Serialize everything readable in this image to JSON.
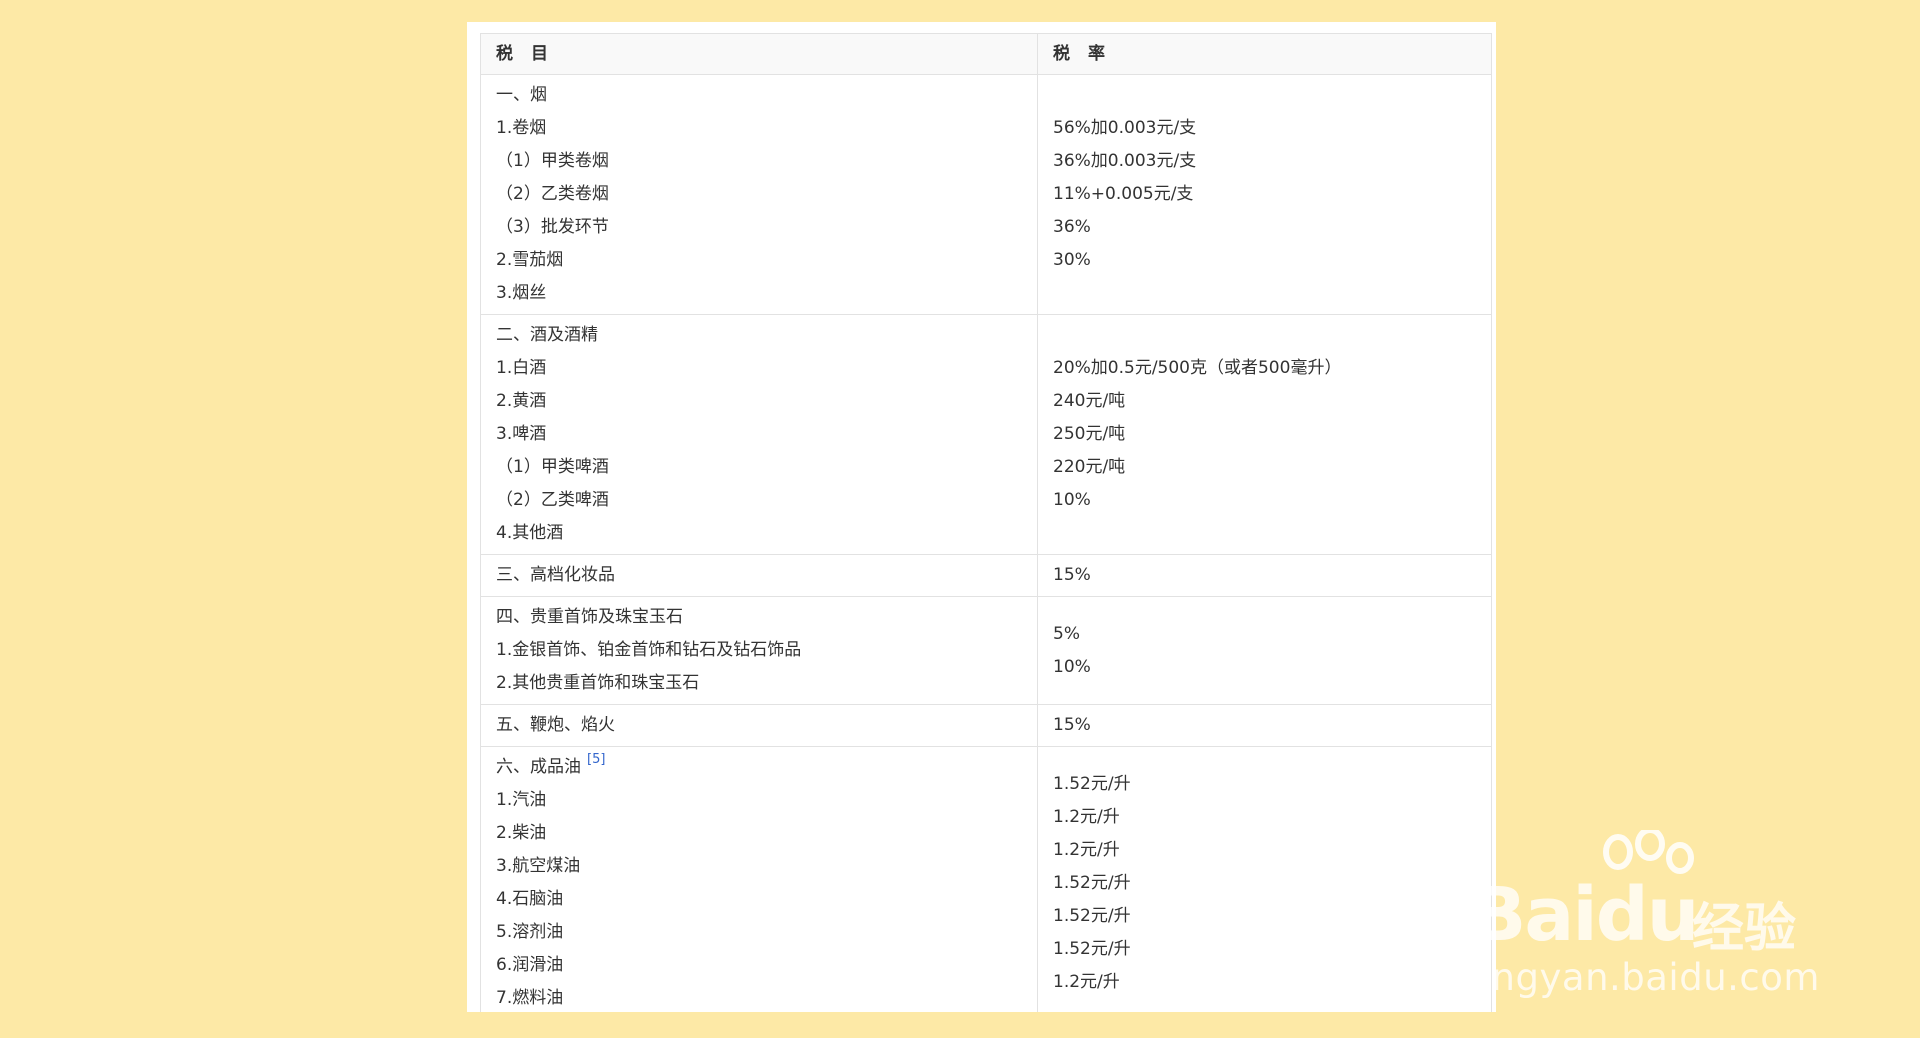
{
  "table": {
    "headers": {
      "item": "税　目",
      "rate": "税　率"
    },
    "sections": [
      {
        "names": [
          "一、烟",
          "1.卷烟",
          "（1）甲类卷烟",
          "（2）乙类卷烟",
          "（3）批发环节",
          "2.雪茄烟",
          "3.烟丝"
        ],
        "rates": [
          "",
          "56%加0.003元/支",
          "36%加0.003元/支",
          "11%+0.005元/支",
          "36%",
          "30%",
          ""
        ]
      },
      {
        "names": [
          "二、酒及酒精",
          "1.白酒",
          "2.黄酒",
          "3.啤酒",
          "（1）甲类啤酒",
          "（2）乙类啤酒",
          "4.其他酒"
        ],
        "rates": [
          "",
          "20%加0.5元/500克（或者500毫升）",
          "240元/吨",
          "250元/吨",
          "220元/吨",
          "10%",
          ""
        ]
      },
      {
        "names": [
          "三、高档化妆品"
        ],
        "rates": [
          "15%"
        ]
      },
      {
        "names": [
          "四、贵重首饰及珠宝玉石",
          "1.金银首饰、铂金首饰和钻石及钻石饰品",
          "2.其他贵重首饰和珠宝玉石"
        ],
        "rates": [
          "5%",
          "10%"
        ]
      },
      {
        "names": [
          "五、鞭炮、焰火"
        ],
        "rates": [
          "15%"
        ]
      },
      {
        "names": [
          "六、成品油",
          "1.汽油",
          "2.柴油",
          "3.航空煤油",
          "4.石脑油",
          "5.溶剂油",
          "6.润滑油",
          "7.燃料油"
        ],
        "ref": "[5]",
        "rates": [
          "1.52元/升",
          "1.2元/升",
          "1.2元/升",
          "1.52元/升",
          "1.52元/升",
          "1.52元/升",
          "1.2元/升"
        ]
      }
    ]
  },
  "watermark": {
    "brand": "Bai",
    "brand_tail": "du",
    "cn": "经验",
    "url": "jingyan.baidu.com"
  }
}
